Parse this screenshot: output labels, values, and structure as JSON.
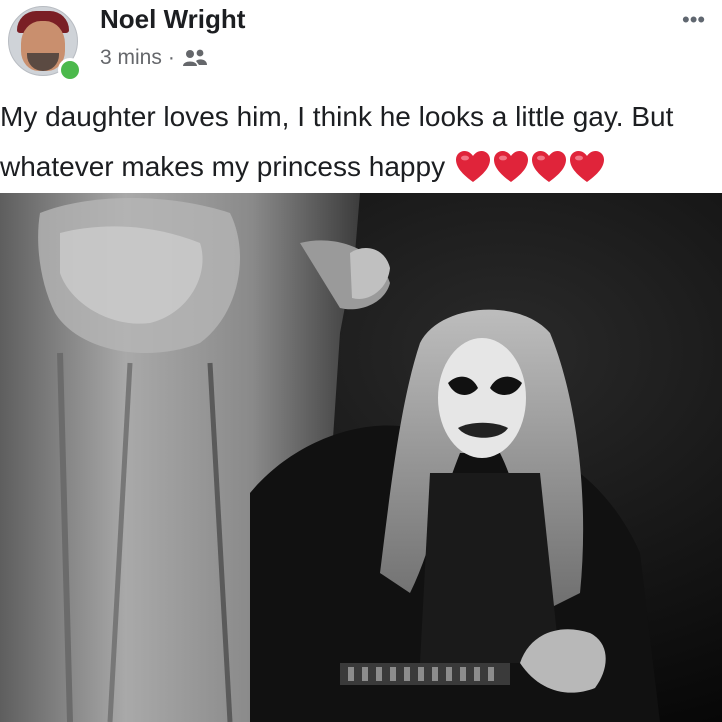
{
  "post": {
    "author": "Noel Wright",
    "timestamp": "3 mins",
    "separator": "·",
    "audience_icon": "friends-icon",
    "more_icon": "•••",
    "text_line1": "My daughter loves him, I think he looks a little gay. But",
    "text_line2": "whatever makes my princess happy",
    "emoji": "heart-emoji",
    "emoji_count": 4,
    "online_status_color": "#4cb94c"
  }
}
